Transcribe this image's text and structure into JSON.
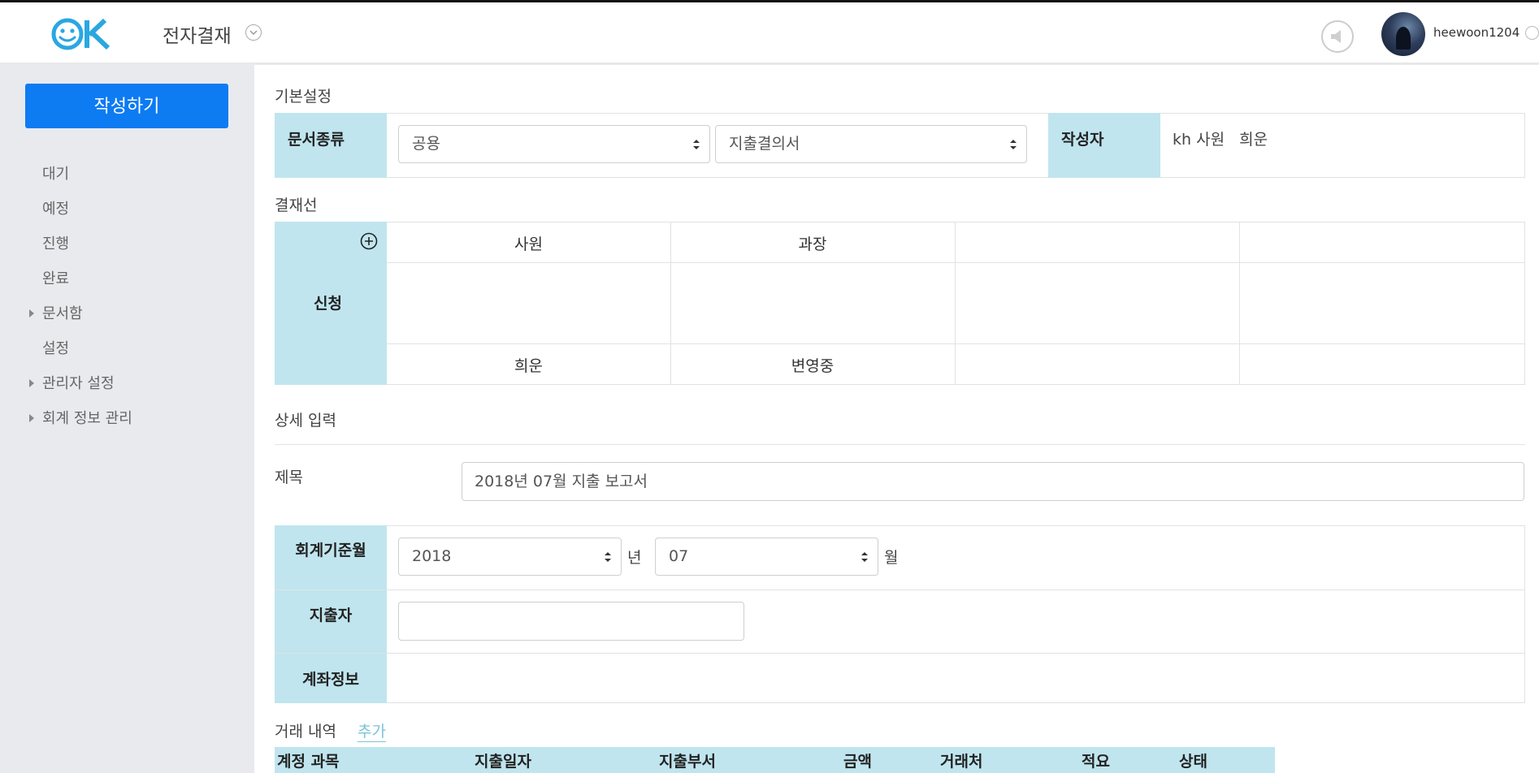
{
  "header": {
    "app_title": "전자결재",
    "username": "heewoon1204",
    "brand_color": "#0d7bf2",
    "logo_color": "#2aa7e0"
  },
  "sidebar": {
    "write_button": "작성하기",
    "items": [
      {
        "label": "대기",
        "expandable": false
      },
      {
        "label": "예정",
        "expandable": false
      },
      {
        "label": "진행",
        "expandable": false
      },
      {
        "label": "완료",
        "expandable": false
      },
      {
        "label": "문서함",
        "expandable": true
      },
      {
        "label": "설정",
        "expandable": false
      },
      {
        "label": "관리자 설정",
        "expandable": true
      },
      {
        "label": "회계 정보 관리",
        "expandable": true
      }
    ]
  },
  "basic": {
    "section_title": "기본설정",
    "doc_type_label": "문서종류",
    "doc_type_value": "공용",
    "doc_form_value": "지출결의서",
    "author_label": "작성자",
    "author_value": "kh 사원   희운"
  },
  "approval": {
    "section_title": "결재선",
    "row_label": "신청",
    "positions": [
      "사원",
      "과장",
      "",
      ""
    ],
    "names": [
      "희운",
      "변영중",
      "",
      ""
    ]
  },
  "detail": {
    "section_title": "상세 입력",
    "title_label": "제목",
    "title_value": "2018년 07월 지출 보고서",
    "period_label": "회계기준월",
    "year_value": "2018",
    "year_suffix": "년",
    "month_value": "07",
    "month_suffix": "월",
    "spender_label": "지출자",
    "spender_value": "",
    "account_label": "계좌정보"
  },
  "transactions": {
    "section_title": "거래 내역",
    "add_link": "추가",
    "columns": [
      "계정 과목",
      "지출일자",
      "지출부서",
      "금액",
      "거래처",
      "적요",
      "상태"
    ]
  },
  "colors": {
    "label_bg": "#c0e5ee",
    "sidebar_bg": "#e8eaed",
    "primary": "#0d7bf2"
  }
}
